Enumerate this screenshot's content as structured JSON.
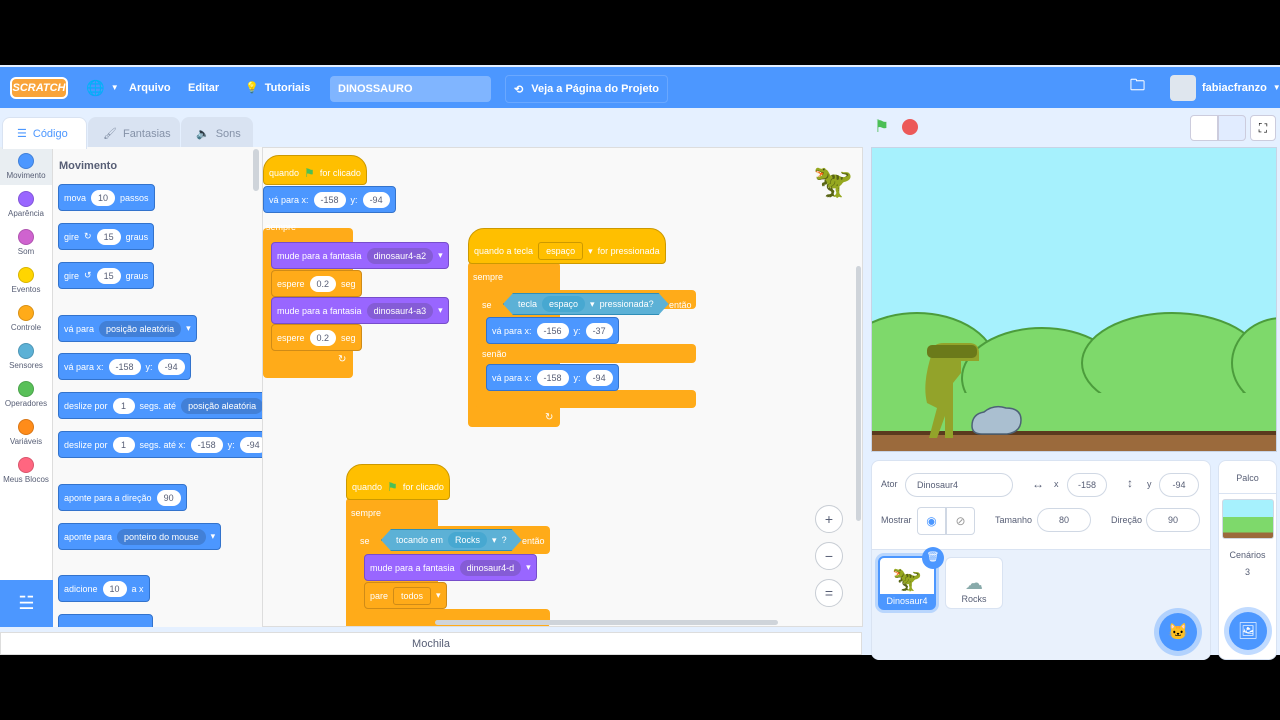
{
  "menu": {
    "logo": "SCRATCH",
    "language_icon": "globe-icon",
    "file": "Arquivo",
    "edit": "Editar",
    "tutorials": "Tutoriais",
    "project_title": "DINOSSAURO",
    "see_project": "Veja a Página do Projeto",
    "username": "fabiacfranzo"
  },
  "tabs": [
    {
      "label": "Código",
      "icon": "code-icon"
    },
    {
      "label": "Fantasias",
      "icon": "brush-icon"
    },
    {
      "label": "Sons",
      "icon": "speaker-icon"
    }
  ],
  "categories": [
    {
      "label": "Movimento",
      "color": "#4c97ff"
    },
    {
      "label": "Aparência",
      "color": "#9966ff"
    },
    {
      "label": "Som",
      "color": "#cf63cf"
    },
    {
      "label": "Eventos",
      "color": "#ffd500"
    },
    {
      "label": "Controle",
      "color": "#ffab19"
    },
    {
      "label": "Sensores",
      "color": "#5cb1d6"
    },
    {
      "label": "Operadores",
      "color": "#59c059"
    },
    {
      "label": "Variáveis",
      "color": "#ff8c1a"
    },
    {
      "label": "Meus Blocos",
      "color": "#ff6680"
    }
  ],
  "palette": {
    "heading": "Movimento",
    "blocks": {
      "move": [
        "mova",
        "10",
        "passos"
      ],
      "turn_right": [
        "gire",
        "15",
        "graus"
      ],
      "turn_left": [
        "gire",
        "15",
        "graus"
      ],
      "goto": [
        "vá para",
        "posição aleatória"
      ],
      "gotoxy": [
        "vá para x:",
        "-158",
        "y:",
        "-94"
      ],
      "glide": [
        "deslize por",
        "1",
        "segs. até",
        "posição aleatória"
      ],
      "glidexy": [
        "deslize por",
        "1",
        "segs. até x:",
        "-158",
        "y:",
        "-94"
      ],
      "point_dir": [
        "aponte  para a direção",
        "90"
      ],
      "point_to": [
        "aponte para",
        "ponteiro do mouse"
      ],
      "change_x": [
        "adicione",
        "10",
        "a x"
      ]
    }
  },
  "scripts": {
    "s1": {
      "hat": [
        "quando",
        "for clicado"
      ],
      "goto": [
        "vá para x:",
        "-158",
        "y:",
        "-94"
      ],
      "forever": "sempre",
      "costume1": [
        "mude para a fantasia",
        "dinosaur4-a2"
      ],
      "wait1": [
        "espere",
        "0.2",
        "seg"
      ],
      "costume2": [
        "mude para a fantasia",
        "dinosaur4-a3"
      ],
      "wait2": [
        "espere",
        "0.2",
        "seg"
      ]
    },
    "s2": {
      "hat": [
        "quando a tecla",
        "espaço",
        "for pressionada"
      ],
      "forever": "sempre",
      "if": [
        "se",
        "tecla",
        "espaço",
        "pressionada?",
        "então"
      ],
      "goto1": [
        "vá para x:",
        "-156",
        "y:",
        "-37"
      ],
      "else": "senão",
      "goto2": [
        "vá para x:",
        "-158",
        "y:",
        "-94"
      ]
    },
    "s3": {
      "hat": [
        "quando",
        "for clicado"
      ],
      "forever": "sempre",
      "if": [
        "se",
        "tocando em",
        "Rocks",
        "?",
        "então"
      ],
      "costume": [
        "mude para a fantasia",
        "dinosaur4-d"
      ],
      "stop": [
        "pare",
        "todos"
      ]
    }
  },
  "backpack": "Mochila",
  "sprite_info": {
    "sprite_label": "Ator",
    "sprite_name": "Dinosaur4",
    "x_label": "x",
    "x": "-158",
    "y_label": "y",
    "y": "-94",
    "show_label": "Mostrar",
    "size_label": "Tamanho",
    "size": "80",
    "direction_label": "Direção",
    "direction": "90"
  },
  "sprites": [
    {
      "name": "Dinosaur4",
      "selected": true
    },
    {
      "name": "Rocks",
      "selected": false
    }
  ],
  "stage_panel": {
    "title": "Palco",
    "backdrops_label": "Cenários",
    "backdrops_count": "3"
  },
  "colors": {
    "motion": "#4c97ff",
    "looks": "#9966ff",
    "control": "#ffab19",
    "events": "#ffbf00",
    "sensing": "#5cb1d6",
    "menubar": "#4c97ff"
  }
}
